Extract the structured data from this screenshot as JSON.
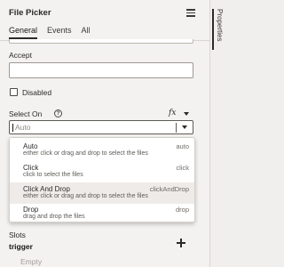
{
  "header": {
    "title": "File Picker"
  },
  "tabs": [
    {
      "label": "General"
    },
    {
      "label": "Events"
    },
    {
      "label": "All"
    }
  ],
  "accept": {
    "label": "Accept",
    "value": ""
  },
  "disabled": {
    "label": "Disabled",
    "checked": false
  },
  "select_on": {
    "label": "Select On",
    "fx_label": "fx",
    "value": "Auto",
    "options": [
      {
        "name": "Auto",
        "key": "auto",
        "desc": "either click or drag and drop to select the files"
      },
      {
        "name": "Click",
        "key": "click",
        "desc": "click to select the files"
      },
      {
        "name": "Click And Drop",
        "key": "clickAndDrop",
        "desc": "either click or drag and drop to select the files"
      },
      {
        "name": "Drop",
        "key": "drop",
        "desc": "drag and drop the files"
      }
    ]
  },
  "slots": {
    "label": "Slots",
    "name": "trigger",
    "empty": "Empty"
  },
  "side_panel": {
    "label": "Properties"
  },
  "colors": {
    "text": "#161513",
    "panel": "#f4f2f0",
    "hover": "#eeebe8"
  }
}
